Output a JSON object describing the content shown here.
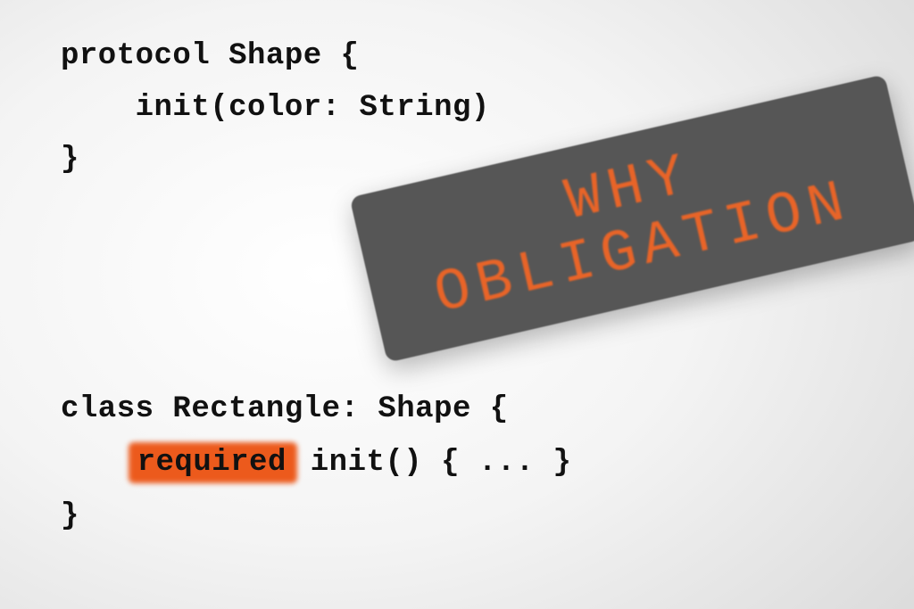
{
  "code": {
    "line1": "protocol Shape {",
    "line2_indent": "    ",
    "line2_text": "init(color: String)",
    "line3": "}",
    "line4": "class Rectangle: Shape {",
    "line5_indent": "    ",
    "line5_keyword": "required",
    "line5_rest": " init() { ... }",
    "line6": "}"
  },
  "stamp": {
    "line1": "WHY",
    "line2": "OBLIGATION"
  },
  "colors": {
    "highlight": "#ec5a1c",
    "stamp_bg": "#565656",
    "stamp_text": "#e86428"
  }
}
